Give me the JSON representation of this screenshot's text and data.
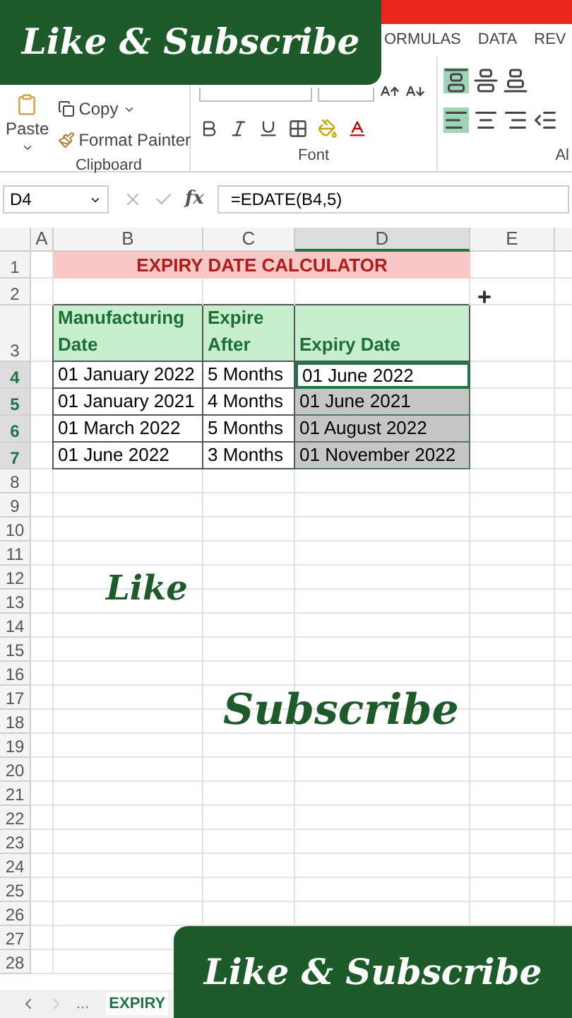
{
  "overlays": {
    "top_banner": "Like & Subscribe",
    "like": "Like",
    "subscribe": "Subscribe",
    "bottom_banner": "Like & Subscribe"
  },
  "ribbon_tabs": [
    {
      "label": "ORMULAS",
      "selected": false
    },
    {
      "label": "DATA",
      "selected": false
    },
    {
      "label": "REV",
      "selected": false
    }
  ],
  "clipboard": {
    "paste": "Paste",
    "copy": "Copy",
    "format_painter": "Format Painter",
    "label": "Clipboard"
  },
  "font": {
    "label": "Font"
  },
  "alignment": {
    "label": "Al",
    "top_align_on": true,
    "left_align_on": true
  },
  "formula_bar": {
    "name_box": "D4",
    "fx": "fx",
    "formula": "=EDATE(B4,5)"
  },
  "columns": [
    {
      "label": "A",
      "selected": false
    },
    {
      "label": "B",
      "selected": false
    },
    {
      "label": "C",
      "selected": false
    },
    {
      "label": "D",
      "selected": true
    },
    {
      "label": "E",
      "selected": false
    }
  ],
  "rows": [
    {
      "label": "1",
      "kind": "title",
      "selected": false,
      "title": "EXPIRY DATE CALCULATOR"
    },
    {
      "label": "2",
      "kind": "blank",
      "selected": false
    },
    {
      "label": "3",
      "kind": "header",
      "selected": false,
      "cells": [
        {
          "text": "Manufacturing Date"
        },
        {
          "text": "Expire After"
        },
        {
          "text": "Expiry Date"
        }
      ]
    },
    {
      "label": "4",
      "kind": "data",
      "selected": true,
      "cells": [
        {
          "text": "01 January 2022",
          "selected": false,
          "active": false
        },
        {
          "text": "5 Months",
          "selected": false,
          "active": false
        },
        {
          "text": "01 June 2022",
          "selected": true,
          "active": true
        }
      ]
    },
    {
      "label": "5",
      "kind": "data",
      "selected": true,
      "cells": [
        {
          "text": "01 January 2021",
          "selected": false,
          "active": false
        },
        {
          "text": "4 Months",
          "selected": false,
          "active": false
        },
        {
          "text": "01 June 2021",
          "selected": true,
          "active": false
        }
      ]
    },
    {
      "label": "6",
      "kind": "data",
      "selected": true,
      "cells": [
        {
          "text": "01 March 2022",
          "selected": false,
          "active": false
        },
        {
          "text": "5 Months",
          "selected": false,
          "active": false
        },
        {
          "text": "01 August 2022",
          "selected": true,
          "active": false
        }
      ]
    },
    {
      "label": "7",
      "kind": "data",
      "selected": true,
      "cells": [
        {
          "text": "01 June 2022",
          "selected": false,
          "active": false
        },
        {
          "text": "3 Months",
          "selected": false,
          "active": false
        },
        {
          "text": "01 November 2022",
          "selected": true,
          "active": false
        }
      ]
    },
    {
      "label": "8",
      "kind": "blank",
      "selected": false
    },
    {
      "label": "9",
      "kind": "blank",
      "selected": false
    },
    {
      "label": "10",
      "kind": "blank",
      "selected": false
    },
    {
      "label": "11",
      "kind": "blank",
      "selected": false
    },
    {
      "label": "12",
      "kind": "blank",
      "selected": false
    },
    {
      "label": "13",
      "kind": "blank",
      "selected": false
    },
    {
      "label": "14",
      "kind": "blank",
      "selected": false
    },
    {
      "label": "15",
      "kind": "blank",
      "selected": false
    },
    {
      "label": "16",
      "kind": "blank",
      "selected": false
    },
    {
      "label": "17",
      "kind": "blank",
      "selected": false
    },
    {
      "label": "18",
      "kind": "blank",
      "selected": false
    },
    {
      "label": "19",
      "kind": "blank",
      "selected": false
    },
    {
      "label": "20",
      "kind": "blank",
      "selected": false
    },
    {
      "label": "21",
      "kind": "blank",
      "selected": false
    },
    {
      "label": "22",
      "kind": "blank",
      "selected": false
    },
    {
      "label": "23",
      "kind": "blank",
      "selected": false
    },
    {
      "label": "24",
      "kind": "blank",
      "selected": false
    },
    {
      "label": "25",
      "kind": "blank",
      "selected": false
    },
    {
      "label": "26",
      "kind": "blank",
      "selected": false
    },
    {
      "label": "27",
      "kind": "blank",
      "selected": false
    },
    {
      "label": "28",
      "kind": "blank",
      "selected": false
    }
  ],
  "sheet_tabs": {
    "more": "...",
    "tabs": [
      {
        "label": "EXPIRY",
        "selected": true
      }
    ]
  }
}
